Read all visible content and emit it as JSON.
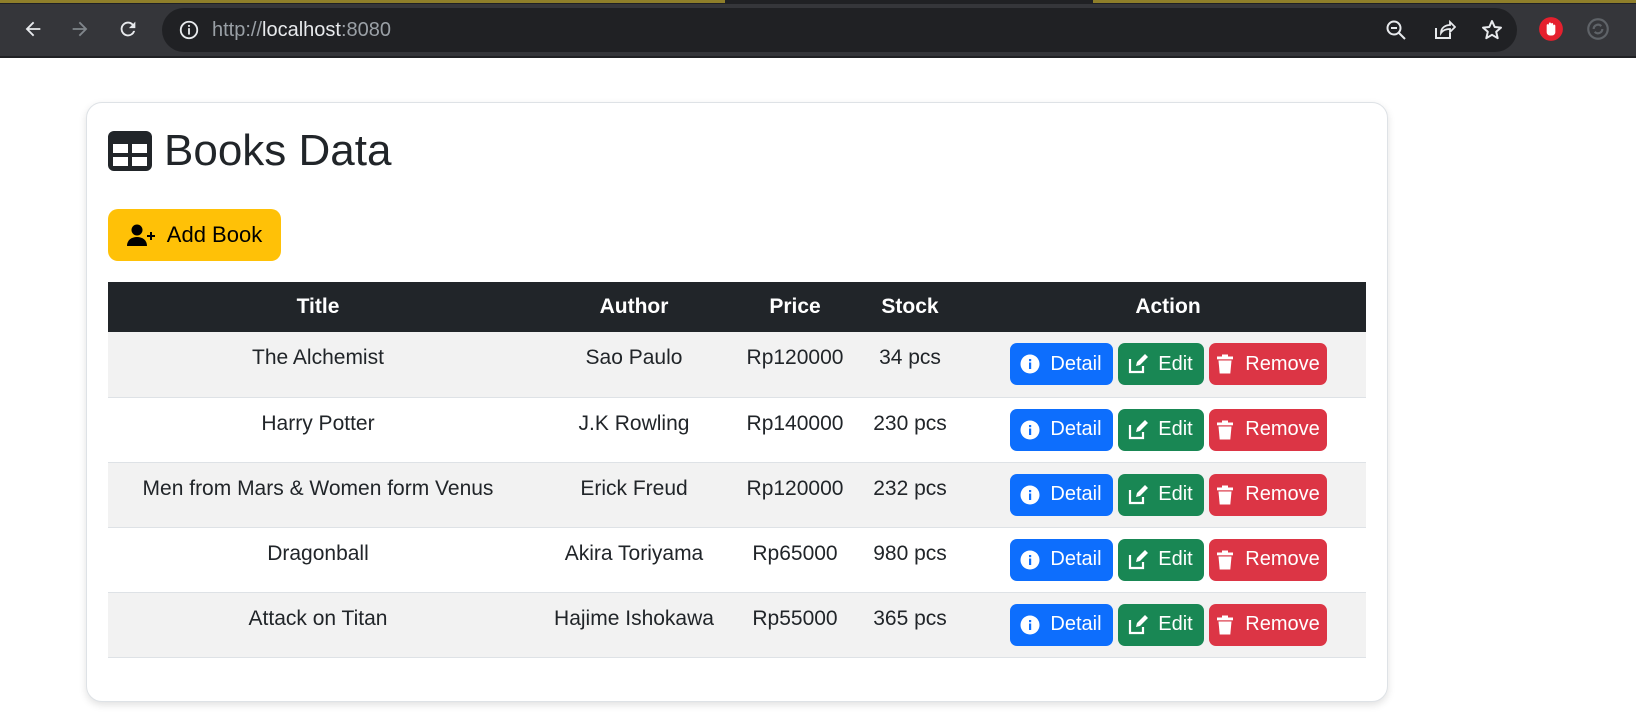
{
  "browser": {
    "url_scheme": "http://",
    "url_host": "localhost",
    "url_port": ":8080",
    "icons": [
      "back-arrow-icon",
      "forward-arrow-icon",
      "reload-icon",
      "info-icon",
      "zoom-out-icon",
      "share-icon",
      "bookmark-star-icon",
      "adblock-icon",
      "sync-icon"
    ]
  },
  "page": {
    "title": "Books Data",
    "title_icon": "table-icon",
    "add_button_label": "Add Book",
    "add_button_icon": "user-plus-icon"
  },
  "table": {
    "headers": [
      "Title",
      "Author",
      "Price",
      "Stock",
      "Action"
    ],
    "rows": [
      {
        "title": "The Alchemist",
        "author": "Sao Paulo",
        "price": "Rp120000",
        "stock": "34 pcs"
      },
      {
        "title": "Harry Potter",
        "author": "J.K Rowling",
        "price": "Rp140000",
        "stock": "230 pcs"
      },
      {
        "title": "Men from Mars & Women form Venus",
        "author": "Erick Freud",
        "price": "Rp120000",
        "stock": "232 pcs"
      },
      {
        "title": "Dragonball",
        "author": "Akira Toriyama",
        "price": "Rp65000",
        "stock": "980 pcs"
      },
      {
        "title": "Attack on Titan",
        "author": "Hajime Ishokawa",
        "price": "Rp55000",
        "stock": "365 pcs"
      }
    ],
    "actions": {
      "detail": "Detail",
      "edit": "Edit",
      "remove": "Remove"
    }
  },
  "colors": {
    "warning": "#ffc107",
    "primary": "#0d6efd",
    "success": "#198754",
    "danger": "#dc3545",
    "dark": "#212529"
  }
}
